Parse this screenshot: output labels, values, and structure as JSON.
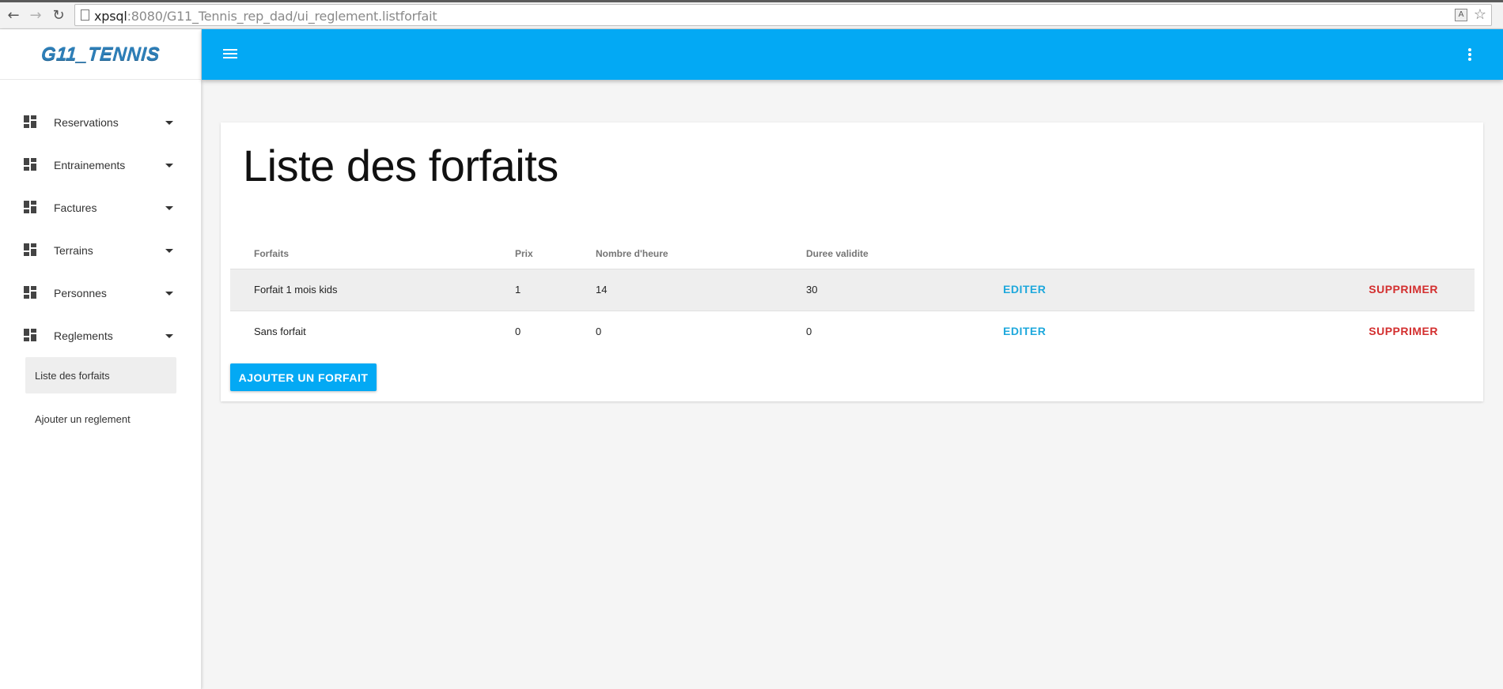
{
  "browser": {
    "url_host": "xpsql",
    "url_path": ":8080/G11_Tennis_rep_dad/ui_reglement.listforfait"
  },
  "sidebar": {
    "logo": "G11_TENNIS",
    "items": [
      {
        "label": "Reservations",
        "icon": "dashboard-icon"
      },
      {
        "label": "Entrainements",
        "icon": "dashboard-icon"
      },
      {
        "label": "Factures",
        "icon": "dashboard-icon"
      },
      {
        "label": "Terrains",
        "icon": "dashboard-icon"
      },
      {
        "label": "Personnes",
        "icon": "dashboard-icon"
      },
      {
        "label": "Reglements",
        "icon": "dashboard-icon"
      }
    ],
    "sub_items": [
      {
        "label": "Liste des forfaits",
        "active": true
      },
      {
        "label": "Ajouter un reglement",
        "active": false
      }
    ]
  },
  "appbar": {
    "color": "#03a9f4",
    "menu_icon": "hamburger-menu-icon",
    "more_icon": "more-vert-icon"
  },
  "main": {
    "title": "Liste des forfaits",
    "table": {
      "columns": [
        "Forfaits",
        "Prix",
        "Nombre d'heure",
        "Duree validite"
      ],
      "rows": [
        {
          "forfait": "Forfait 1 mois kids",
          "prix": "1",
          "nombre_heure": "14",
          "duree_validite": "30",
          "edit": "EDITER",
          "delete": "SUPPRIMER"
        },
        {
          "forfait": "Sans forfait",
          "prix": "0",
          "nombre_heure": "0",
          "duree_validite": "0",
          "edit": "EDITER",
          "delete": "SUPPRIMER"
        }
      ]
    },
    "add_button": "AJOUTER UN FORFAIT"
  },
  "colors": {
    "accent": "#03a9f4",
    "edit": "#1ea8dc",
    "delete": "#d32f2f"
  }
}
